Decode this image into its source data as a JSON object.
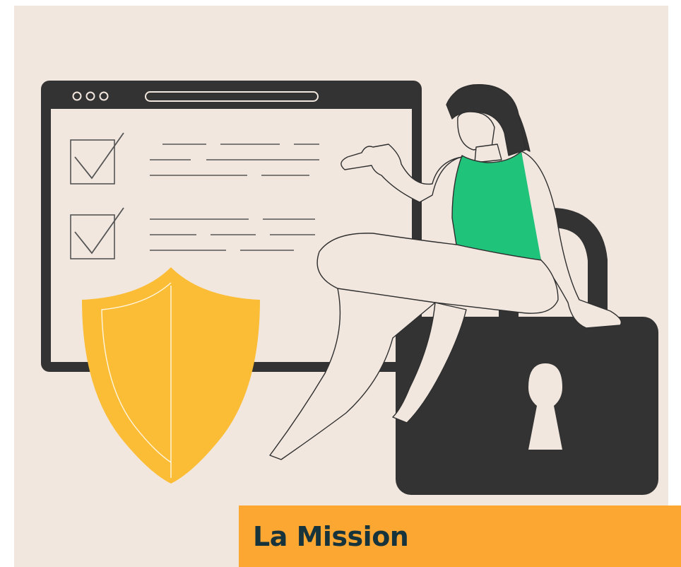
{
  "banner": {
    "title": "La Mission"
  },
  "illustration": {
    "browser_window": {
      "icon": "browser-window-icon",
      "color": "#333333",
      "dots": 3,
      "checklist_items": 2
    },
    "shield": {
      "icon": "shield-icon",
      "color": "#fbbd35"
    },
    "person": {
      "icon": "person-icon",
      "top_color": "#1fc37a"
    },
    "padlock": {
      "icon": "padlock-icon",
      "color": "#333333",
      "keyhole_color": "#f1e7df"
    }
  },
  "colors": {
    "background": "#f1e7df",
    "banner": "#fca732",
    "banner_text": "#17343c"
  }
}
